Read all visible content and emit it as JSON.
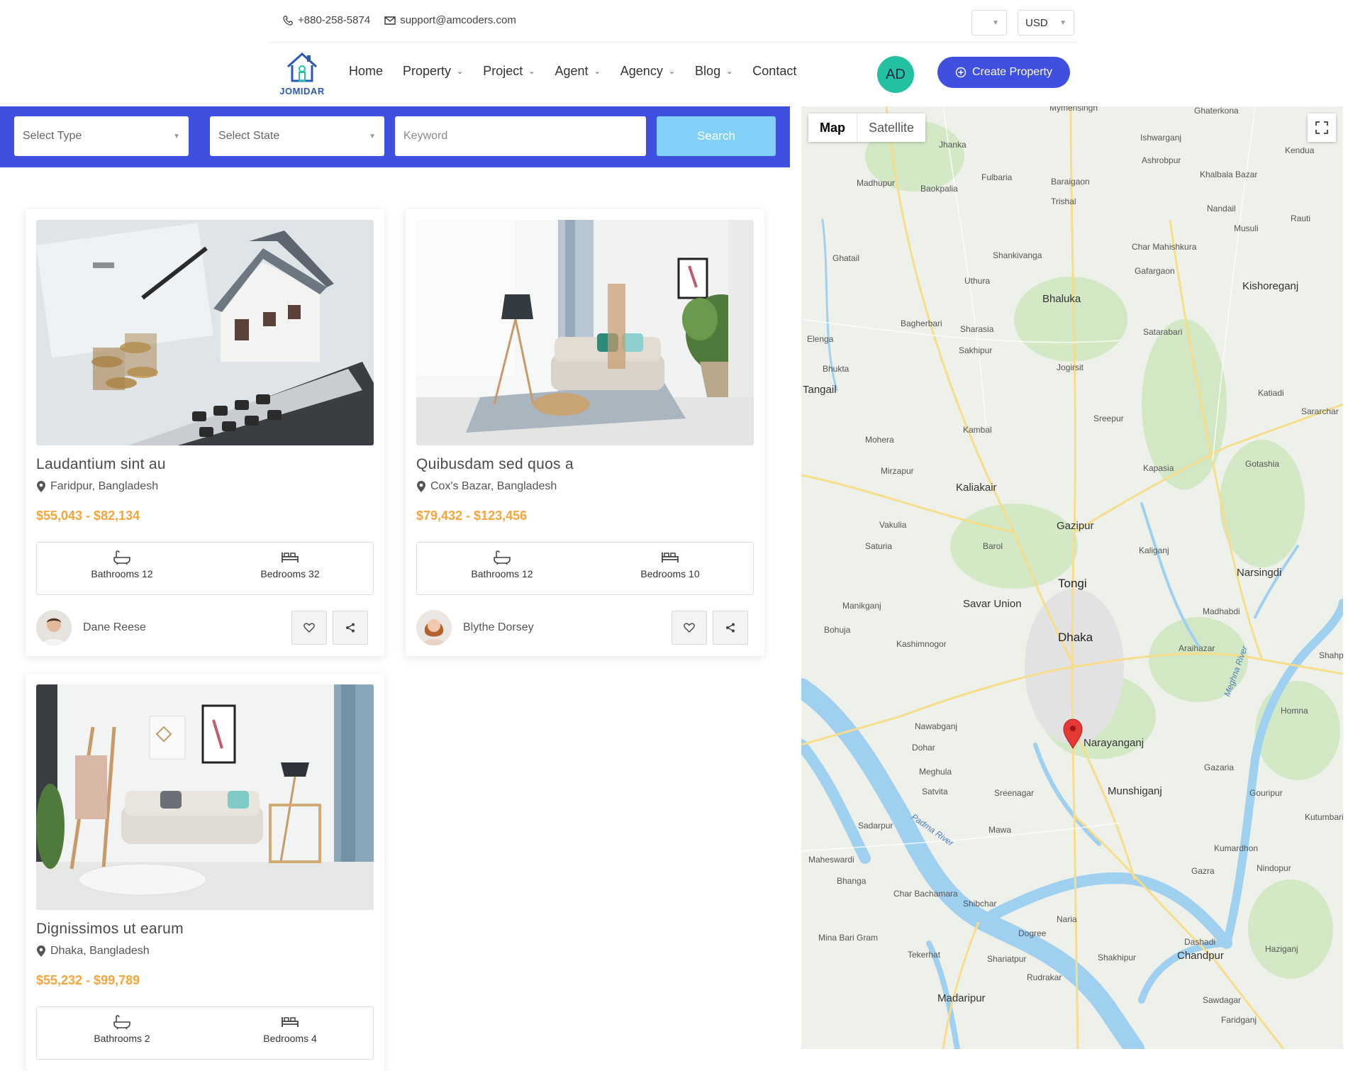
{
  "topbar": {
    "phone": "+880-258-5874",
    "email": "support@amcoders.com",
    "language_value": "",
    "currency_value": "USD"
  },
  "nav": {
    "logo_text": "JOMIDAR",
    "items": [
      {
        "label": "Home",
        "dropdown": false
      },
      {
        "label": "Property",
        "dropdown": true
      },
      {
        "label": "Project",
        "dropdown": true
      },
      {
        "label": "Agent",
        "dropdown": true
      },
      {
        "label": "Agency",
        "dropdown": true
      },
      {
        "label": "Blog",
        "dropdown": true
      },
      {
        "label": "Contact",
        "dropdown": false
      }
    ],
    "avatar_initials": "AD",
    "create_label": "Create Property"
  },
  "search": {
    "type_value": "Select Type",
    "state_value": "Select State",
    "keyword_placeholder": "Keyword",
    "button_label": "Search"
  },
  "listings": [
    {
      "title": "Laudantium sint au",
      "location": "Faridpur, Bangladesh",
      "price": "$55,043 - $82,134",
      "bathrooms": "Bathrooms 12",
      "bedrooms": "Bedrooms 32",
      "agent": "Dane Reese"
    },
    {
      "title": "Quibusdam sed quos a",
      "location": "Cox's Bazar, Bangladesh",
      "price": "$79,432 - $123,456",
      "bathrooms": "Bathrooms 12",
      "bedrooms": "Bedrooms 10",
      "agent": "Blythe Dorsey"
    },
    {
      "title": "Dignissimos ut earum",
      "location": "Dhaka, Bangladesh",
      "price": "$55,232 - $99,789",
      "bathrooms": "Bathrooms 2",
      "bedrooms": "Bedrooms 4",
      "agent": ""
    }
  ],
  "map": {
    "type_map": "Map",
    "type_satellite": "Satellite",
    "places": [
      "Mymensingh",
      "Ghaterkona",
      "Jhanka",
      "Ishwarganj",
      "Ashrobpur",
      "Kendua",
      "Khalbala Bazar",
      "Madhupur",
      "Baokpalia",
      "Fulbaria",
      "Baraigaon",
      "Trishal",
      "Nandail",
      "Musuli",
      "Rauti",
      "Ghatail",
      "Shankivanga",
      "Char Mahishkura",
      "Gafargaon",
      "Uthura",
      "Kishoreganj",
      "Bhaluka",
      "Bagherbari",
      "Sharasia",
      "Satarabari",
      "Elenga",
      "Sakhipur",
      "Bhukta",
      "Jogirsit",
      "Tangail",
      "Katiadi",
      "Sararchar",
      "Sreepur",
      "Kambal",
      "Mohera",
      "Gotashia",
      "Mirzapur",
      "Kapasia",
      "Kaliakair",
      "Vakulia",
      "Gazipur",
      "Saturia",
      "Barol",
      "Kaliganj",
      "Narsingdi",
      "Tongi",
      "Manikganj",
      "Savar Union",
      "Madhabdi",
      "Bohuja",
      "Kashimnogor",
      "Dhaka",
      "Araihazar",
      "Meghna River",
      "Shahpur",
      "Homna",
      "Nawabganj",
      "Dohar",
      "Narayanganj",
      "Gazaria",
      "Meghula",
      "Satvita",
      "Sreenagar",
      "Munshiganj",
      "Gouripur",
      "Kutumbari",
      "Sadarpur",
      "Mawa",
      "Padma River",
      "Kumardhon",
      "Maheswardi",
      "Gazra",
      "Nindopur",
      "Bhanga",
      "Char Bachamara",
      "Shibchar",
      "Naria",
      "Dogree",
      "Dashadi",
      "Mina Bari Gram",
      "Tekerhat",
      "Shariatpur",
      "Chandpur",
      "Haziganj",
      "Shakhipur",
      "Rudrakar",
      "Madaripur",
      "Sawdagar",
      "Faridganj"
    ]
  },
  "colors": {
    "brand": "#3f4fe0",
    "search_button": "#82cff7",
    "price": "#f7a43b",
    "avatar": "#21c1a1",
    "map_pin": "#e53935"
  },
  "icons": [
    "phone-icon",
    "mail-icon",
    "house-logo-icon",
    "chevron-down-icon",
    "plus-circle-icon",
    "location-pin-icon",
    "bathtub-icon",
    "bed-icon",
    "heart-icon",
    "share-icon",
    "fullscreen-icon",
    "map-marker-icon"
  ]
}
